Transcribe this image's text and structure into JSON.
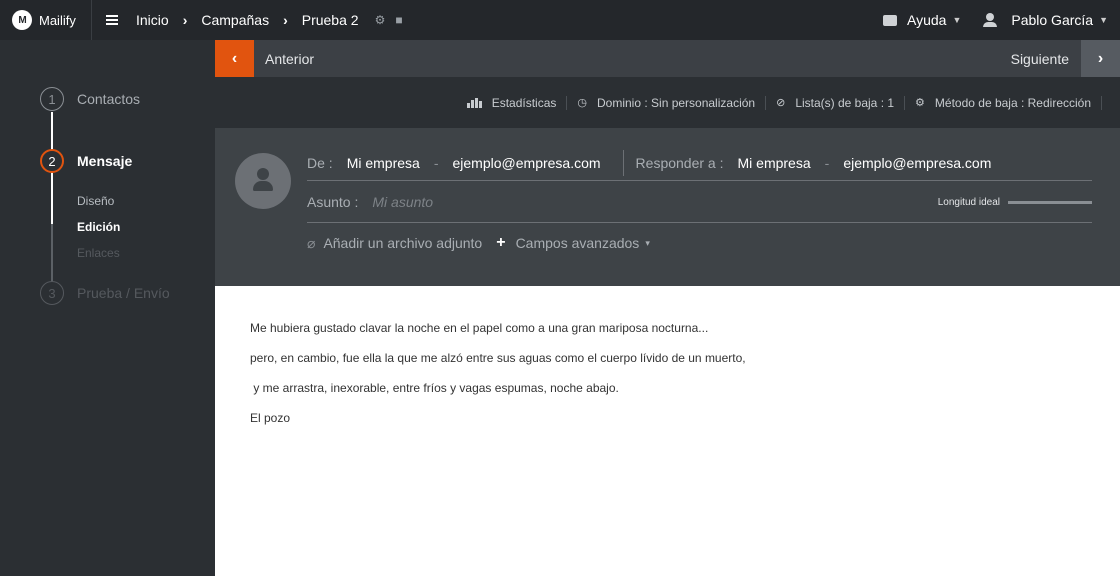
{
  "topbar": {
    "brand": "Mailify",
    "logo_text": "M",
    "breadcrumbs": [
      "Inicio",
      "Campañas",
      "Prueba 2"
    ],
    "help_label": "Ayuda",
    "user_name": "Pablo García"
  },
  "steps": [
    {
      "num": "1",
      "label": "Contactos",
      "state": "done"
    },
    {
      "num": "2",
      "label": "Mensaje",
      "state": "active"
    },
    {
      "num": "3",
      "label": "Prueba / Envío",
      "state": "disabled"
    }
  ],
  "substeps": [
    {
      "label": "Diseño",
      "state": "normal"
    },
    {
      "label": "Edición",
      "state": "current"
    },
    {
      "label": "Enlaces",
      "state": "disabled"
    }
  ],
  "nav": {
    "prev_label": "Anterior",
    "next_label": "Siguiente"
  },
  "info": {
    "stats": "Estadísticas",
    "domain": "Dominio : Sin personalización",
    "unsub_lists": "Lista(s) de baja : 1",
    "unsub_method": "Método de baja : Redirección"
  },
  "header": {
    "from_label": "De :",
    "from_name": "Mi empresa",
    "from_email": "ejemplo@empresa.com",
    "reply_label": "Responder a :",
    "reply_name": "Mi empresa",
    "reply_email": "ejemplo@empresa.com",
    "subject_label": "Asunto :",
    "subject_placeholder": "Mi asunto",
    "ideal_length_label": "Longitud ideal",
    "attach_label": "Añadir un archivo adjunto",
    "advanced_label": "Campos avanzados"
  },
  "body_lines": [
    "Me hubiera gustado clavar la noche en el papel como a una gran mariposa nocturna...",
    "pero, en cambio, fue ella la que me alzó entre sus aguas como el cuerpo lívido de un muerto,",
    " y me arrastra, inexorable, entre fríos y vagas espumas, noche abajo.",
    "El pozo"
  ],
  "colors": {
    "accent": "#e1540f",
    "topbar": "#24272b",
    "sidebar": "#2b2f33",
    "header": "#3e4347"
  }
}
